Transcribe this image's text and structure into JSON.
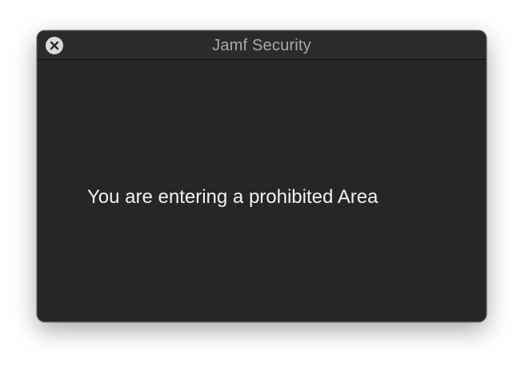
{
  "window": {
    "title": "Jamf Security",
    "close_icon": "close-circle-icon"
  },
  "main": {
    "message": "You are entering a prohibited Area"
  },
  "colors": {
    "window_background": "#262626",
    "titlebar_background": "#2b2b2b",
    "title_text": "#a9a9a9",
    "message_text": "#f2f2f2",
    "close_button": "#d9d9d9"
  }
}
